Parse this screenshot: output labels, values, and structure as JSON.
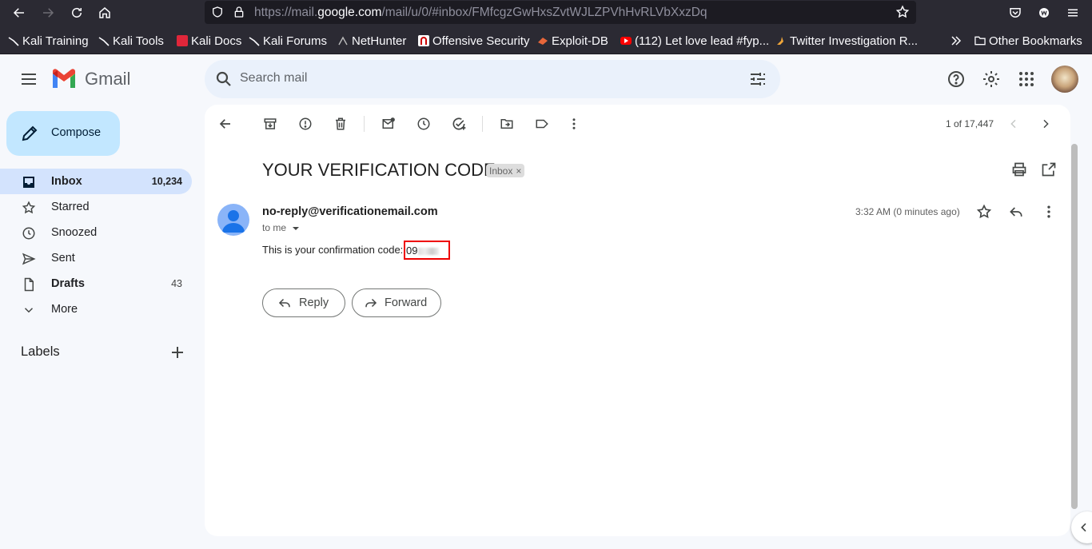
{
  "browser": {
    "url_prefix": "https://mail.",
    "url_host": "google.com",
    "url_path": "/mail/u/0/#inbox/FMfcgzGwHxsZvtWJLZPVhHvRLVbXxzDq",
    "bookmarks": [
      "Kali Training",
      "Kali Tools",
      "Kali Docs",
      "Kali Forums",
      "NetHunter",
      "Offensive Security",
      "Exploit-DB",
      "(112) Let love lead #fyp...",
      "Twitter Investigation R..."
    ],
    "other_bookmarks": "Other Bookmarks"
  },
  "gmail": {
    "logo_text": "Gmail",
    "search_placeholder": "Search mail",
    "compose_label": "Compose",
    "nav": [
      {
        "label": "Inbox",
        "count": "10,234"
      },
      {
        "label": "Starred",
        "count": ""
      },
      {
        "label": "Snoozed",
        "count": ""
      },
      {
        "label": "Sent",
        "count": ""
      },
      {
        "label": "Drafts",
        "count": "43"
      },
      {
        "label": "More",
        "count": ""
      }
    ],
    "labels_heading": "Labels"
  },
  "message": {
    "pagination": "1 of 17,447",
    "subject": "YOUR VERIFICATION CODE",
    "chip": "Inbox",
    "chip_close": "×",
    "sender": "no-reply@verificationemail.com",
    "to": "to me",
    "time": "3:32 AM (0 minutes ago)",
    "body": "This is your confirmation code:",
    "code_visible": "09",
    "reply_label": "Reply",
    "forward_label": "Forward"
  },
  "colors": {
    "browser_bg": "#2b2a33",
    "gmail_bg": "#f6f8fc",
    "compose_bg": "#c2e7ff",
    "inbox_active_bg": "#d3e3fd",
    "highlight_border": "#ee0000"
  }
}
